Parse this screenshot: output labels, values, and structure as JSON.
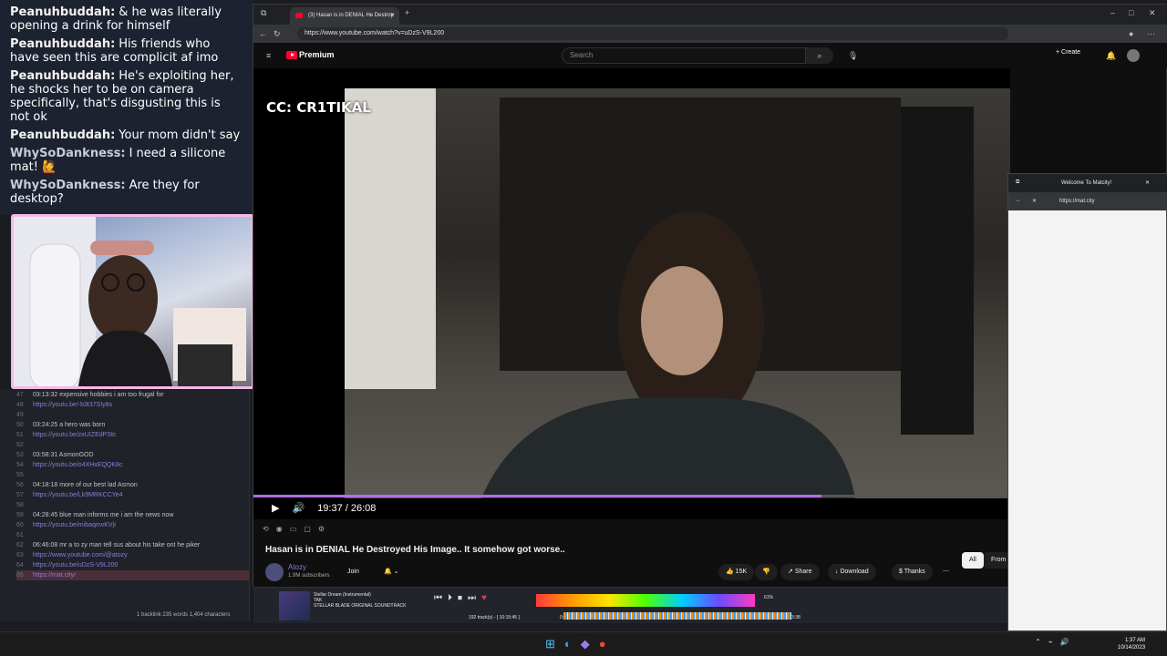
{
  "chat": {
    "messages": [
      {
        "user": "Peanuhbuddah:",
        "text": "& he was literally opening a drink for himself",
        "kind": "p"
      },
      {
        "user": "Peanuhbuddah:",
        "text": "His friends who have seen this are complicit af imo",
        "kind": "p"
      },
      {
        "user": "Peanuhbuddah:",
        "text": "He's exploiting her, he shocks her to be on camera specifically, that's disgusting this is not ok",
        "kind": "p"
      },
      {
        "user": "Peanuhbuddah:",
        "text": "Your mom didn't say",
        "kind": "p"
      },
      {
        "user": "WhySoDankness:",
        "text": "I need a silicone mat! 🙋",
        "kind": "w"
      },
      {
        "user": "WhySoDankness:",
        "text": "Are they for desktop?",
        "kind": "w"
      }
    ]
  },
  "notes": {
    "lines": [
      {
        "num": "47",
        "text": "03:13:32 expensive hobbies i am too frugal for",
        "link": false
      },
      {
        "num": "48",
        "text": "https://youtu.be/-b3t37SIy8s",
        "link": true
      },
      {
        "num": "49",
        "text": "",
        "link": false
      },
      {
        "num": "50",
        "text": "03:24:25 a hero was born",
        "link": false
      },
      {
        "num": "51",
        "text": "https://youtu.be/zxUIZEdPStc",
        "link": true
      },
      {
        "num": "52",
        "text": "",
        "link": false
      },
      {
        "num": "53",
        "text": "03:58:31  AsmonGOD",
        "link": false
      },
      {
        "num": "54",
        "text": "https://youtu.be/o4XHxEQQK8c",
        "link": true
      },
      {
        "num": "55",
        "text": "",
        "link": false
      },
      {
        "num": "56",
        "text": "04:18:18 more of our best lad Asmon",
        "link": false
      },
      {
        "num": "57",
        "text": "https://youtu.be/Lk9MRKCCYe4",
        "link": true
      },
      {
        "num": "58",
        "text": "",
        "link": false
      },
      {
        "num": "59",
        "text": "04:28:45  blue man informs me i am the news now",
        "link": false
      },
      {
        "num": "60",
        "text": "https://youtu.be/mibaqmvKVjI",
        "link": true
      },
      {
        "num": "61",
        "text": "",
        "link": false
      },
      {
        "num": "62",
        "text": "06:46:08  mr a to zy man tell sus about his take ont he piker",
        "link": false
      },
      {
        "num": "63",
        "text": "https://www.youtube.com/@atozy",
        "link": true
      },
      {
        "num": "64",
        "text": "https://youtu.be/uDzS-V9L200",
        "link": true
      },
      {
        "num": "65",
        "text": "https://mat.city/",
        "link": true
      }
    ],
    "status": "1 backlink    235 words  1,404 characters"
  },
  "browser": {
    "tab_title": "(3) Hasan is in DENIAL He Destroy",
    "url": "https://www.youtube.com/watch?v=uDzS-V9L200"
  },
  "youtube": {
    "logo": "Premium",
    "search_placeholder": "Search",
    "create": "Create",
    "cc_label": "CC: CR1TIKAL",
    "time": "19:37 / 26:08",
    "progress": 0.75,
    "title": "Hasan is in DENIAL He Destroyed His Image.. It somehow got worse..",
    "channel": "Atozy",
    "subs": "1.9M subscribers",
    "join": "Join",
    "likes": "15K",
    "share": "Share",
    "download": "Download",
    "thanks": "Thanks",
    "chip_all": "All",
    "chip_from": "From A"
  },
  "popup": {
    "tab_title": "Welcome To Matcity!",
    "url": "https://mat.city"
  },
  "media": {
    "track": "Stellar Dream (Instrumental)",
    "artist": "TAK",
    "album": "STELLAR BLADE ORIGINAL SOUNDTRACK",
    "tracks": "192 track(s) - [ 10:15:45 ]",
    "elapsed": "0:04",
    "duration": "3:38",
    "volume": "61%"
  },
  "taskbar": {
    "time": "1:37 AM",
    "date": "10/14/2023"
  }
}
